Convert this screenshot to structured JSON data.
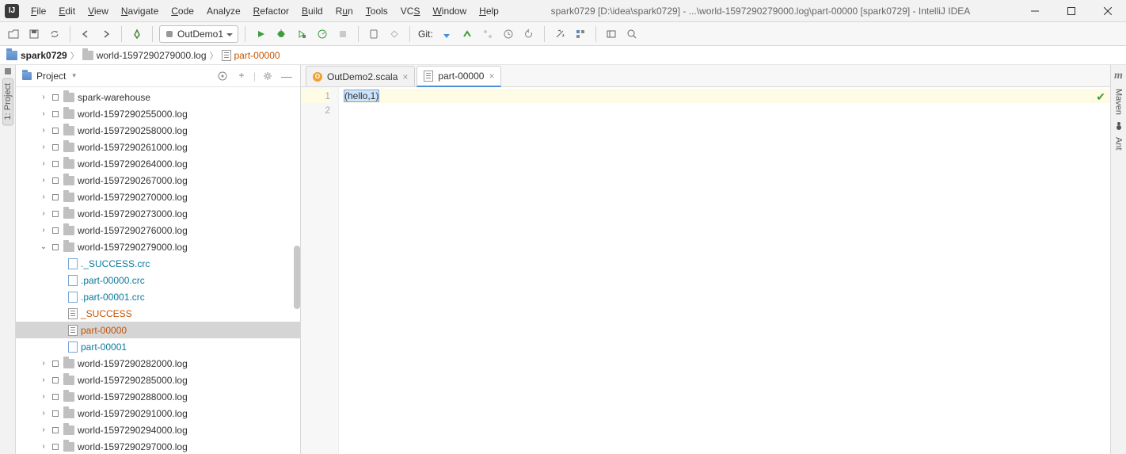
{
  "menu": {
    "file": "File",
    "edit": "Edit",
    "view": "View",
    "navigate": "Navigate",
    "code": "Code",
    "analyze": "Analyze",
    "refactor": "Refactor",
    "build": "Build",
    "run": "Run",
    "tools": "Tools",
    "vcs": "VCS",
    "window": "Window",
    "help": "Help"
  },
  "title": "spark0729 [D:\\idea\\spark0729] - ...\\world-1597290279000.log\\part-00000 [spark0729] - IntelliJ IDEA",
  "run_config": "OutDemo1",
  "git_label": "Git:",
  "breadcrumb": {
    "root": "spark0729",
    "dir": "world-1597290279000.log",
    "file": "part-00000"
  },
  "sidebar": {
    "project_tab": "1: Project"
  },
  "panel": {
    "title": "Project"
  },
  "tree": {
    "items": [
      {
        "depth": 1,
        "arrow": "›",
        "icon": "folder",
        "name": "spark-warehouse",
        "cls": ""
      },
      {
        "depth": 1,
        "arrow": "›",
        "icon": "folder",
        "name": "world-1597290255000.log",
        "cls": ""
      },
      {
        "depth": 1,
        "arrow": "›",
        "icon": "folder",
        "name": "world-1597290258000.log",
        "cls": ""
      },
      {
        "depth": 1,
        "arrow": "›",
        "icon": "folder",
        "name": "world-1597290261000.log",
        "cls": ""
      },
      {
        "depth": 1,
        "arrow": "›",
        "icon": "folder",
        "name": "world-1597290264000.log",
        "cls": ""
      },
      {
        "depth": 1,
        "arrow": "›",
        "icon": "folder",
        "name": "world-1597290267000.log",
        "cls": ""
      },
      {
        "depth": 1,
        "arrow": "›",
        "icon": "folder",
        "name": "world-1597290270000.log",
        "cls": ""
      },
      {
        "depth": 1,
        "arrow": "›",
        "icon": "folder",
        "name": "world-1597290273000.log",
        "cls": ""
      },
      {
        "depth": 1,
        "arrow": "›",
        "icon": "folder",
        "name": "world-1597290276000.log",
        "cls": ""
      },
      {
        "depth": 1,
        "arrow": "⌄",
        "icon": "folder",
        "name": "world-1597290279000.log",
        "cls": ""
      },
      {
        "depth": 2,
        "arrow": "",
        "icon": "crc",
        "name": "._SUCCESS.crc",
        "cls": "changed"
      },
      {
        "depth": 2,
        "arrow": "",
        "icon": "crc",
        "name": ".part-00000.crc",
        "cls": "changed"
      },
      {
        "depth": 2,
        "arrow": "",
        "icon": "crc",
        "name": ".part-00001.crc",
        "cls": "changed"
      },
      {
        "depth": 2,
        "arrow": "",
        "icon": "file",
        "name": "_SUCCESS",
        "cls": "brown"
      },
      {
        "depth": 2,
        "arrow": "",
        "icon": "file",
        "name": "part-00000",
        "cls": "brown",
        "selected": true
      },
      {
        "depth": 2,
        "arrow": "",
        "icon": "crc",
        "name": "part-00001",
        "cls": "changed"
      },
      {
        "depth": 1,
        "arrow": "›",
        "icon": "folder",
        "name": "world-1597290282000.log",
        "cls": ""
      },
      {
        "depth": 1,
        "arrow": "›",
        "icon": "folder",
        "name": "world-1597290285000.log",
        "cls": ""
      },
      {
        "depth": 1,
        "arrow": "›",
        "icon": "folder",
        "name": "world-1597290288000.log",
        "cls": ""
      },
      {
        "depth": 1,
        "arrow": "›",
        "icon": "folder",
        "name": "world-1597290291000.log",
        "cls": ""
      },
      {
        "depth": 1,
        "arrow": "›",
        "icon": "folder",
        "name": "world-1597290294000.log",
        "cls": ""
      },
      {
        "depth": 1,
        "arrow": "›",
        "icon": "folder",
        "name": "world-1597290297000.log",
        "cls": ""
      }
    ]
  },
  "tabs": [
    {
      "icon": "o",
      "label": "OutDemo2.scala",
      "active": false
    },
    {
      "icon": "file",
      "label": "part-00000",
      "active": true
    }
  ],
  "editor": {
    "lines": [
      "(hello,1)",
      ""
    ],
    "line_numbers": [
      "1",
      "2"
    ]
  },
  "right": {
    "maven": "Maven",
    "ant": "Ant"
  }
}
